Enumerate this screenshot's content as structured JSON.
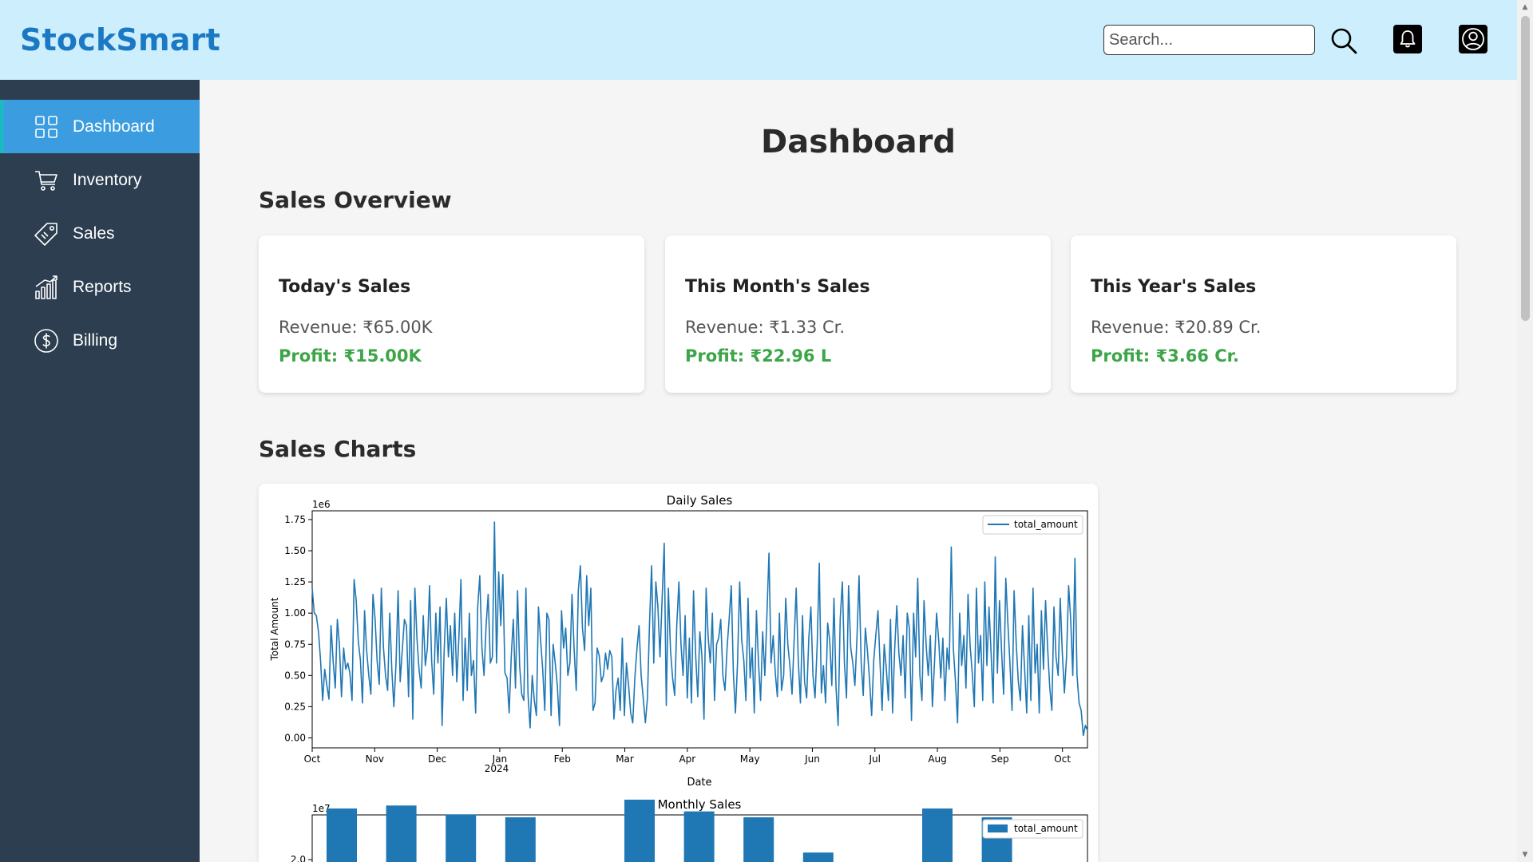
{
  "app": {
    "brand": "StockSmart"
  },
  "header": {
    "search_placeholder": "Search..."
  },
  "sidebar": {
    "items": [
      {
        "label": "Dashboard",
        "icon": "grid-icon",
        "active": true
      },
      {
        "label": "Inventory",
        "icon": "cart-icon",
        "active": false
      },
      {
        "label": "Sales",
        "icon": "tag-icon",
        "active": false
      },
      {
        "label": "Reports",
        "icon": "bar-chart-icon",
        "active": false
      },
      {
        "label": "Billing",
        "icon": "dollar-circle-icon",
        "active": false
      }
    ]
  },
  "main": {
    "title": "Dashboard",
    "sales_overview_title": "Sales Overview",
    "sales_charts_title": "Sales Charts",
    "cards": [
      {
        "title": "Today's Sales",
        "revenue": "Revenue: ₹65.00K",
        "profit": "Profit: ₹15.00K"
      },
      {
        "title": "This Month's Sales",
        "revenue": "Revenue: ₹1.33 Cr.",
        "profit": "Profit: ₹22.96 L"
      },
      {
        "title": "This Year's Sales",
        "revenue": "Revenue: ₹20.89 Cr.",
        "profit": "Profit: ₹3.66 Cr."
      }
    ]
  },
  "colors": {
    "accent": "#3b9de0",
    "sidebar_bg": "#2c3e50",
    "header_bg": "#cdeefc",
    "profit": "#3da547",
    "series": "#1f77b4"
  },
  "chart_data": [
    {
      "type": "line",
      "title": "Daily Sales",
      "xlabel": "Date",
      "ylabel": "Total Amount",
      "y_offset_label": "1e6",
      "legend": [
        "total_amount"
      ],
      "legend_position": "top-right",
      "x_ticks": [
        "Oct",
        "Nov",
        "Dec",
        "Jan",
        "Feb",
        "Mar",
        "Apr",
        "May",
        "Jun",
        "Jul",
        "Aug",
        "Sep",
        "Oct"
      ],
      "x_year_label": "2024",
      "y_ticks": [
        "0.00",
        "0.25",
        "0.50",
        "0.75",
        "1.00",
        "1.25",
        "1.50",
        "1.75"
      ],
      "ylim": [
        -0.08,
        1.82
      ],
      "series": [
        {
          "name": "total_amount",
          "values": [
            1.2,
            1.0,
            0.98,
            0.85,
            0.62,
            0.3,
            0.55,
            0.42,
            0.31,
            0.9,
            0.62,
            0.4,
            0.95,
            0.75,
            0.33,
            0.72,
            0.55,
            0.6,
            0.52,
            0.3,
            1.27,
            1.1,
            0.78,
            0.62,
            0.28,
            1.02,
            0.7,
            0.5,
            0.35,
            1.15,
            0.96,
            0.61,
            0.43,
            1.2,
            0.73,
            0.5,
            0.38,
            1.0,
            0.55,
            0.25,
            0.6,
            1.18,
            0.45,
            0.7,
            0.95,
            0.9,
            0.33,
            1.1,
            0.15,
            1.2,
            0.8,
            0.55,
            0.4,
            0.98,
            0.58,
            0.72,
            1.22,
            0.62,
            0.35,
            1.0,
            0.6,
            1.05,
            0.1,
            0.7,
            1.12,
            0.65,
            0.9,
            0.5,
            1.0,
            0.45,
            0.8,
            1.27,
            0.3,
            0.8,
            0.38,
            1.0,
            0.5,
            0.62,
            0.2,
            1.05,
            1.3,
            0.72,
            0.5,
            0.9,
            1.15,
            0.6,
            0.65,
            1.73,
            0.6,
            1.33,
            0.9,
            1.31,
            0.52,
            0.48,
            0.2,
            0.65,
            0.95,
            0.4,
            1.18,
            0.58,
            0.35,
            0.3,
            1.2,
            0.35,
            0.08,
            0.5,
            0.3,
            0.18,
            1.05,
            0.78,
            0.55,
            0.22,
            1.0,
            0.95,
            0.18,
            0.75,
            0.6,
            0.42,
            0.1,
            1.02,
            0.72,
            0.88,
            0.5,
            0.6,
            1.15,
            0.72,
            0.38,
            1.18,
            1.38,
            0.88,
            0.7,
            1.3,
            0.9,
            1.2,
            0.22,
            0.28,
            0.72,
            0.66,
            0.45,
            0.5,
            0.68,
            0.55,
            0.7,
            0.65,
            0.15,
            0.38,
            0.48,
            0.22,
            0.8,
            0.18,
            0.6,
            0.42,
            0.2,
            0.12,
            0.48,
            0.72,
            0.9,
            0.5,
            0.32,
            0.12,
            0.32,
            0.92,
            1.38,
            0.6,
            1.25,
            1.05,
            0.65,
            1.12,
            1.56,
            0.26,
            1.2,
            0.7,
            0.48,
            0.34,
            0.9,
            1.25,
            0.75,
            0.5,
            0.98,
            0.32,
            0.8,
            0.28,
            1.18,
            0.66,
            0.33,
            0.85,
            0.66,
            0.15,
            1.2,
            0.8,
            0.6,
            1.0,
            0.3,
            0.75,
            0.8,
            0.95,
            0.5,
            0.38,
            0.72,
            0.95,
            1.22,
            0.52,
            0.2,
            0.6,
            1.25,
            0.78,
            0.62,
            0.3,
            1.12,
            0.48,
            0.72,
            0.2,
            1.02,
            0.6,
            0.3,
            0.85,
            0.5,
            0.98,
            1.48,
            0.6,
            0.82,
            0.52,
            0.33,
            1.0,
            0.38,
            0.5,
            1.12,
            0.75,
            0.58,
            0.35,
            0.78,
            1.2,
            0.62,
            0.28,
            0.98,
            0.45,
            0.32,
            0.8,
            1.05,
            0.5,
            0.32,
            0.75,
            1.4,
            0.36,
            0.58,
            0.28,
            0.92,
            0.78,
            0.42,
            1.12,
            0.4,
            0.1,
            0.95,
            1.25,
            0.6,
            0.32,
            1.22,
            0.72,
            0.6,
            0.42,
            0.8,
            1.3,
            0.6,
            0.34,
            0.88,
            0.7,
            0.46,
            0.18,
            0.62,
            0.82,
            1.02,
            0.6,
            0.22,
            0.75,
            0.55,
            0.3,
            0.95,
            0.2,
            0.72,
            1.06,
            0.68,
            0.5,
            0.82,
            0.32,
            1.0,
            0.88,
            0.14,
            1.0,
            0.65,
            1.28,
            0.5,
            0.3,
            1.1,
            0.75,
            0.5,
            0.82,
            0.25,
            0.6,
            1.0,
            0.78,
            0.48,
            0.8,
            0.3,
            0.72,
            0.55,
            1.53,
            0.72,
            0.45,
            0.12,
            1.0,
            0.58,
            0.82,
            0.4,
            1.15,
            0.74,
            0.52,
            0.25,
            1.2,
            0.6,
            0.82,
            0.3,
            1.25,
            0.58,
            1.05,
            0.68,
            0.28,
            1.45,
            0.52,
            1.1,
            0.7,
            0.35,
            1.28,
            0.92,
            0.6,
            0.22,
            1.18,
            0.75,
            0.45,
            0.3,
            0.9,
            0.55,
            0.2,
            0.98,
            0.3,
            1.2,
            0.52,
            0.75,
            0.2,
            1.02,
            0.55,
            1.1,
            0.72,
            0.4,
            0.22,
            1.05,
            0.65,
            0.5,
            1.12,
            0.68,
            0.36,
            0.65,
            1.22,
            0.95,
            0.5,
            1.44,
            0.5,
            0.28,
            0.22,
            0.02,
            0.1,
            0.06
          ]
        }
      ]
    },
    {
      "type": "bar",
      "title": "Monthly Sales",
      "y_offset_label": "1e7",
      "legend": [
        "total_amount"
      ],
      "legend_position": "top-right",
      "y_ticks": [
        "2.0"
      ],
      "ylim": [
        1.9,
        2.3
      ],
      "series": [
        {
          "name": "total_amount",
          "values": [
            2.18,
            2.19,
            2.16,
            2.15,
            null,
            2.21,
            2.17,
            2.15,
            2.03,
            null,
            2.18,
            2.15
          ]
        }
      ]
    }
  ]
}
